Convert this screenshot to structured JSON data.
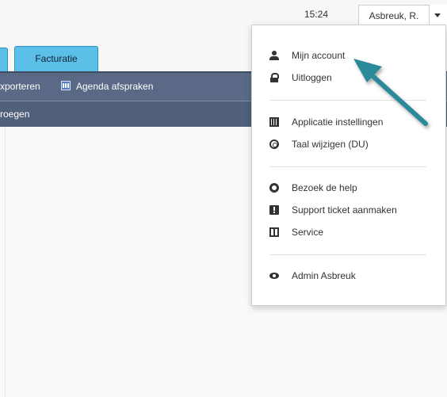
{
  "header": {
    "time": "15:24",
    "user_name": "Asbreuk, R."
  },
  "tabs": [
    {
      "label": "Facturatie"
    }
  ],
  "toolbar": {
    "export_label": "xporteren",
    "agenda_label": "Agenda afspraken"
  },
  "subbar": {
    "label": "roegen"
  },
  "menu": {
    "items": [
      {
        "label": "Mijn account",
        "icon": "user-icon"
      },
      {
        "label": "Uitloggen",
        "icon": "lock-icon"
      },
      {
        "label": "Applicatie instellingen",
        "icon": "settings-grid-icon"
      },
      {
        "label": "Taal wijzigen (DU)",
        "icon": "globe-icon"
      },
      {
        "label": "Bezoek de help",
        "icon": "help-icon"
      },
      {
        "label": "Support ticket aanmaken",
        "icon": "ticket-icon"
      },
      {
        "label": "Service",
        "icon": "service-icon"
      },
      {
        "label": "Admin Asbreuk",
        "icon": "eye-icon"
      }
    ]
  },
  "colors": {
    "tab_bg": "#5bbfe8",
    "toolbar_bg": "#5a6a86",
    "subbar_bg": "#505f7a",
    "arrow": "#2a8a9a"
  }
}
